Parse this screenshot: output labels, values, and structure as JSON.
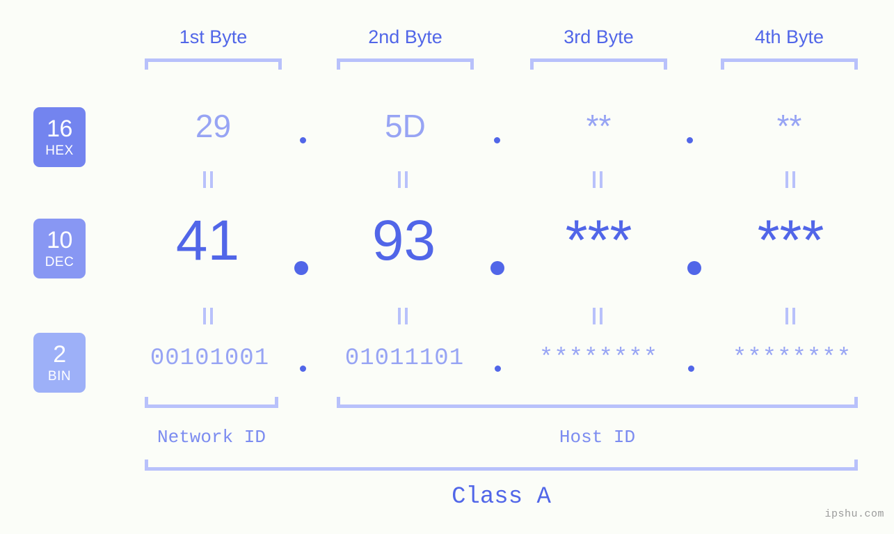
{
  "meta": {
    "background": "#fbfdf8",
    "accent": "#5166e8",
    "accent_light": "#97a4f4",
    "bracket_color": "#b8c1fb",
    "watermark": "ipshu.com"
  },
  "headers": [
    {
      "label": "1st Byte"
    },
    {
      "label": "2nd Byte"
    },
    {
      "label": "3rd Byte"
    },
    {
      "label": "4th Byte"
    }
  ],
  "bases": [
    {
      "num": "16",
      "name": "HEX",
      "color": "#7384ef"
    },
    {
      "num": "10",
      "name": "DEC",
      "color": "#8897f3"
    },
    {
      "num": "2",
      "name": "BIN",
      "color": "#9db0f8"
    }
  ],
  "rows": {
    "hex": {
      "values": [
        "29",
        "5D",
        "**",
        "**"
      ]
    },
    "dec": {
      "values": [
        "41",
        "93",
        "***",
        "***"
      ]
    },
    "bin": {
      "values": [
        "00101001",
        "01011101",
        "********",
        "********"
      ]
    }
  },
  "separator": ".",
  "equals_mark": "=",
  "footer": {
    "network_id": "Network ID",
    "host_id": "Host ID",
    "class": "Class A"
  }
}
